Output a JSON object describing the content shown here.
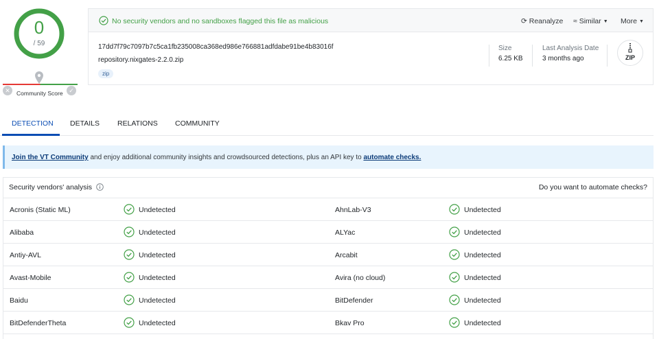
{
  "score": {
    "detected": "0",
    "total": "/ 59",
    "community_label": "Community Score",
    "accent": "#43a047"
  },
  "header": {
    "banner_text": "No security vendors and no sandboxes flagged this file as malicious",
    "actions": {
      "reanalyze": "Reanalyze",
      "similar": "Similar",
      "more": "More"
    },
    "hash": "17dd7f79c7097b7c5ca1fb235008ca368ed986e766881adfdabe91be4b83016f",
    "filename": "repository.nixgates-2.2.0.zip",
    "tag": "zip",
    "size_label": "Size",
    "size_value": "6.25 KB",
    "analysis_label": "Last Analysis Date",
    "analysis_value": "3 months ago",
    "file_type": "ZIP"
  },
  "tabs": [
    "DETECTION",
    "DETAILS",
    "RELATIONS",
    "COMMUNITY"
  ],
  "community_banner": {
    "link1": "Join the VT Community",
    "middle": " and enjoy additional community insights and crowdsourced detections, plus an API key to ",
    "link2": "automate checks."
  },
  "vendors": {
    "title": "Security vendors' analysis",
    "right_text": "Do you want to automate checks?",
    "rows": [
      [
        {
          "name": "Acronis (Static ML)",
          "result": "Undetected"
        },
        {
          "name": "AhnLab-V3",
          "result": "Undetected"
        }
      ],
      [
        {
          "name": "Alibaba",
          "result": "Undetected"
        },
        {
          "name": "ALYac",
          "result": "Undetected"
        }
      ],
      [
        {
          "name": "Antiy-AVL",
          "result": "Undetected"
        },
        {
          "name": "Arcabit",
          "result": "Undetected"
        }
      ],
      [
        {
          "name": "Avast-Mobile",
          "result": "Undetected"
        },
        {
          "name": "Avira (no cloud)",
          "result": "Undetected"
        }
      ],
      [
        {
          "name": "Baidu",
          "result": "Undetected"
        },
        {
          "name": "BitDefender",
          "result": "Undetected"
        }
      ],
      [
        {
          "name": "BitDefenderTheta",
          "result": "Undetected"
        },
        {
          "name": "Bkav Pro",
          "result": "Undetected"
        }
      ]
    ]
  }
}
